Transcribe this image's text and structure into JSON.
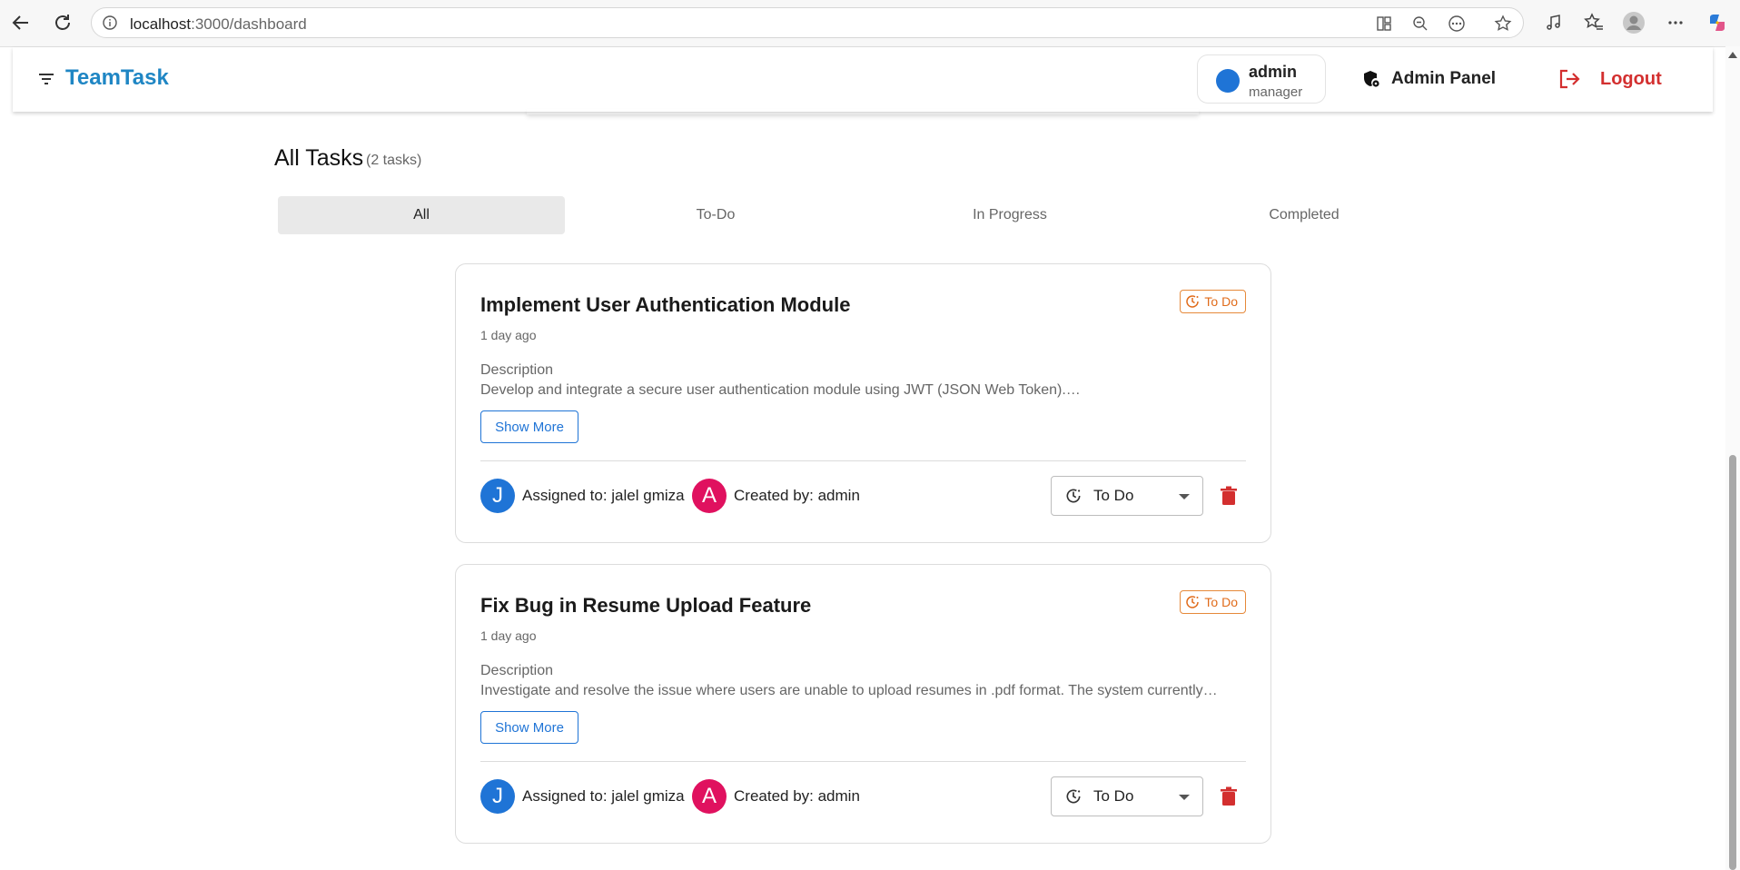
{
  "browser": {
    "url_host": "localhost",
    "url_rest": ":3000/dashboard"
  },
  "header": {
    "brand": "TeamTask",
    "user": {
      "name": "admin",
      "role": "manager"
    },
    "admin_panel_label": "Admin Panel",
    "logout_label": "Logout"
  },
  "page": {
    "title": "All Tasks",
    "count": "(2 tasks)"
  },
  "tabs": [
    {
      "label": "All"
    },
    {
      "label": "To-Do"
    },
    {
      "label": "In Progress"
    },
    {
      "label": "Completed"
    }
  ],
  "tasks": [
    {
      "title": "Implement User Authentication Module",
      "time": "1 day ago",
      "badge": "To Do",
      "desc_label": "Description",
      "description": "Develop and integrate a secure user authentication module using JWT (JSON Web Token).…",
      "show_more": "Show More",
      "assigned_initial": "J",
      "assigned": "Assigned to: jalel gmiza",
      "creator_initial": "A",
      "created": "Created by: admin",
      "status": "To Do"
    },
    {
      "title": "Fix Bug in Resume Upload Feature",
      "time": "1 day ago",
      "badge": "To Do",
      "desc_label": "Description",
      "description": "Investigate and resolve the issue where users are unable to upload resumes in .pdf format. The system currently…",
      "show_more": "Show More",
      "assigned_initial": "J",
      "assigned": "Assigned to: jalel gmiza",
      "creator_initial": "A",
      "created": "Created by: admin",
      "status": "To Do"
    }
  ],
  "colors": {
    "brand": "#1f86c4",
    "assigned_avatar": "#1f74d6",
    "creator_avatar": "#e0115f",
    "badge": "#e06b1a",
    "logout": "#d32f2f",
    "delete": "#d32f2f"
  }
}
